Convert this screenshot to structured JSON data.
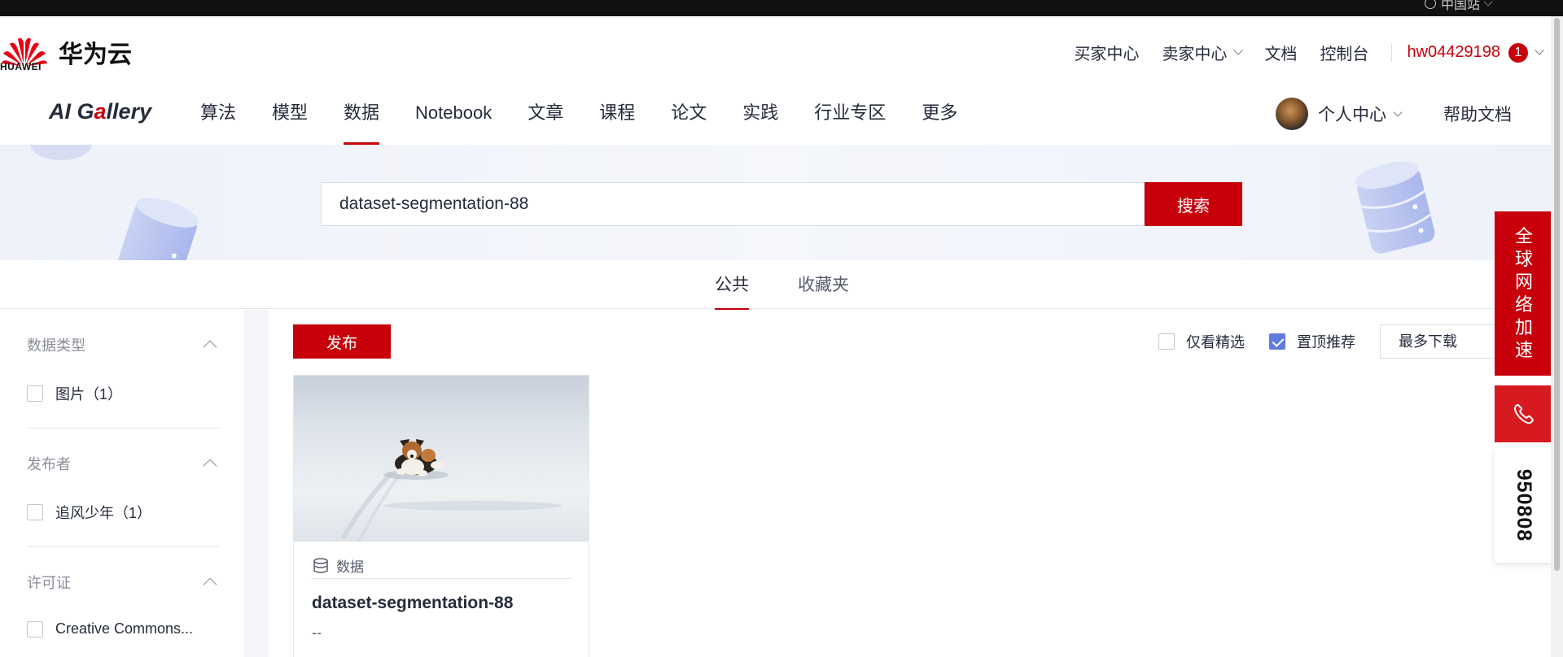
{
  "region": "中国站",
  "header": {
    "logo_text": "HUAWEI",
    "brand": "华为云",
    "links": [
      "买家中心",
      "卖家中心",
      "文档",
      "控制台"
    ],
    "username": "hw04429198",
    "badge": "1"
  },
  "nav": {
    "gallery_a": "AI G",
    "gallery_b": "a",
    "gallery_c": "llery",
    "items": [
      "算法",
      "模型",
      "数据",
      "Notebook",
      "文章",
      "课程",
      "论文",
      "实践",
      "行业专区",
      "更多"
    ],
    "active": "数据",
    "personal_center": "个人中心",
    "help_docs": "帮助文档"
  },
  "search": {
    "value": "dataset-segmentation-88",
    "button": "搜索"
  },
  "tabs": [
    "公共",
    "收藏夹"
  ],
  "sidebar": {
    "facets": [
      {
        "title": "数据类型",
        "options": [
          "图片（1）"
        ]
      },
      {
        "title": "发布者",
        "options": [
          "追风少年（1）"
        ]
      },
      {
        "title": "许可证",
        "options": [
          "Creative Commons..."
        ]
      }
    ]
  },
  "toolbar": {
    "publish": "发布",
    "filter_featured": "仅看精选",
    "filter_pinned": "置顶推荐",
    "sort": "最多下载"
  },
  "card": {
    "type": "数据",
    "title": "dataset-segmentation-88",
    "desc": "--"
  },
  "float": {
    "accelerate": [
      "全",
      "球",
      "网",
      "络",
      "加",
      "速"
    ],
    "phone": "950808"
  },
  "colors": {
    "brand_red": "#c7000b",
    "checkbox_blue": "#5e7ce0"
  }
}
